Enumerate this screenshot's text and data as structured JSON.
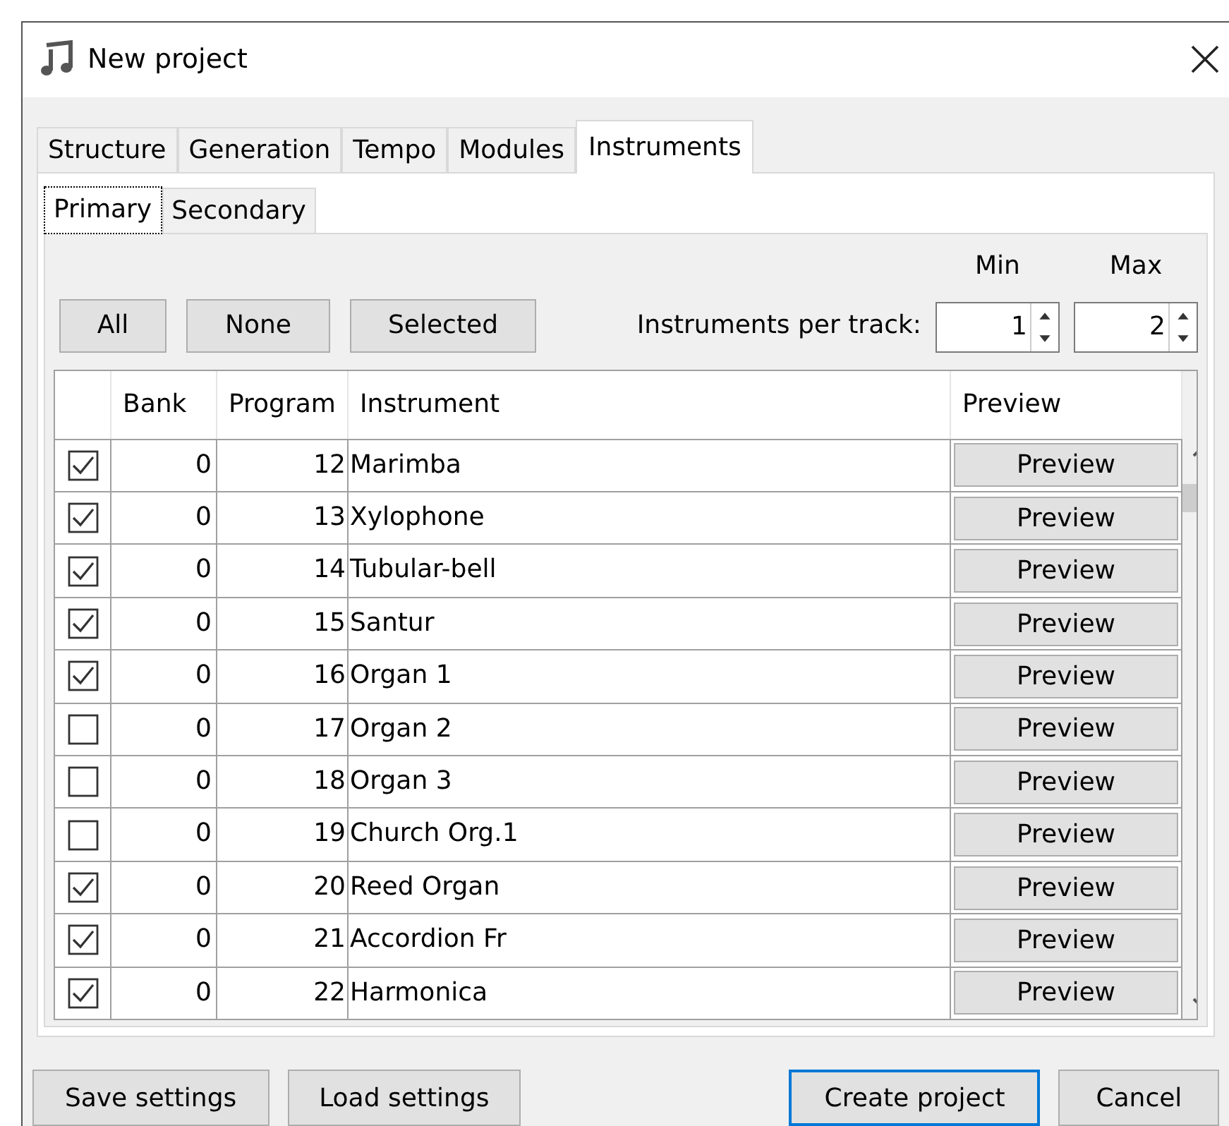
{
  "window": {
    "title": "New project"
  },
  "tabs": [
    {
      "label": "Structure",
      "selected": false
    },
    {
      "label": "Generation",
      "selected": false
    },
    {
      "label": "Tempo",
      "selected": false
    },
    {
      "label": "Modules",
      "selected": false
    },
    {
      "label": "Instruments",
      "selected": true
    }
  ],
  "subtabs": [
    {
      "label": "Primary",
      "selected": true
    },
    {
      "label": "Secondary",
      "selected": false
    }
  ],
  "selection_buttons": [
    "All",
    "None",
    "Selected"
  ],
  "instruments_per_track": {
    "label": "Instruments per track:",
    "min": {
      "header": "Min",
      "value": "1"
    },
    "max": {
      "header": "Max",
      "value": "2"
    }
  },
  "table": {
    "columns": [
      "Bank",
      "Program",
      "Instrument",
      "Preview"
    ],
    "rows": [
      {
        "checked": true,
        "bank": "0",
        "program": "12",
        "instrument": "Marimba",
        "preview": "Preview"
      },
      {
        "checked": true,
        "bank": "0",
        "program": "13",
        "instrument": "Xylophone",
        "preview": "Preview"
      },
      {
        "checked": true,
        "bank": "0",
        "program": "14",
        "instrument": "Tubular-bell",
        "preview": "Preview"
      },
      {
        "checked": true,
        "bank": "0",
        "program": "15",
        "instrument": "Santur",
        "preview": "Preview"
      },
      {
        "checked": true,
        "bank": "0",
        "program": "16",
        "instrument": "Organ 1",
        "preview": "Preview"
      },
      {
        "checked": false,
        "bank": "0",
        "program": "17",
        "instrument": "Organ 2",
        "preview": "Preview"
      },
      {
        "checked": false,
        "bank": "0",
        "program": "18",
        "instrument": "Organ 3",
        "preview": "Preview"
      },
      {
        "checked": false,
        "bank": "0",
        "program": "19",
        "instrument": "Church Org.1",
        "preview": "Preview"
      },
      {
        "checked": true,
        "bank": "0",
        "program": "20",
        "instrument": "Reed Organ",
        "preview": "Preview"
      },
      {
        "checked": true,
        "bank": "0",
        "program": "21",
        "instrument": "Accordion Fr",
        "preview": "Preview"
      },
      {
        "checked": true,
        "bank": "0",
        "program": "22",
        "instrument": "Harmonica",
        "preview": "Preview"
      }
    ]
  },
  "footer_buttons": [
    {
      "label": "Save settings",
      "default": false
    },
    {
      "label": "Load settings",
      "default": false
    },
    {
      "label": "Create project",
      "default": true
    },
    {
      "label": "Cancel",
      "default": false
    }
  ]
}
